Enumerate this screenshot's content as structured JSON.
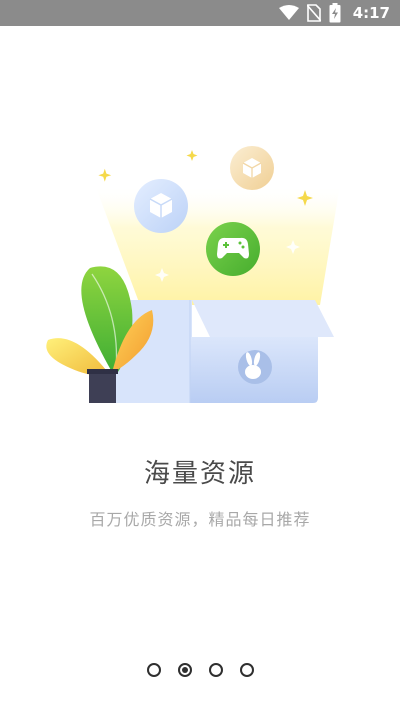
{
  "status_bar": {
    "time": "4:17",
    "icons": [
      "wifi-icon",
      "no-sim-icon",
      "battery-charging-icon"
    ],
    "background": "#8b8b8b"
  },
  "illustration": {
    "icons": [
      "cube-icon",
      "cube-icon",
      "gamepad-icon",
      "rabbit-logo-icon",
      "plant",
      "sparkle-icon"
    ],
    "colors": {
      "green": "#5bc23a",
      "blue_circle": "#cfe0fb",
      "orange_circle": "#f6dfb4",
      "box": "#c8d8f6",
      "glow": "#fff6a8"
    }
  },
  "onboarding": {
    "title": "海量资源",
    "subtitle": "百万优质资源，精品每日推荐"
  },
  "pager": {
    "count": 4,
    "active_index": 1
  }
}
